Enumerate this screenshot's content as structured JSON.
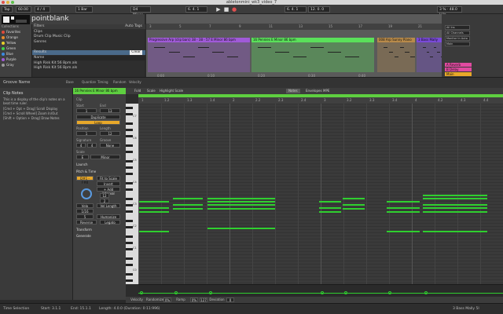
{
  "window_title": "abletonmini_wk3_video_7",
  "transport": {
    "tap": "Tap",
    "tempo": "60.00",
    "sig": "4 / 4",
    "metro": "1 Bar",
    "position": "6. 4. 1",
    "key_root": "D4",
    "key_scale": "Minor",
    "loop_start": "6. 4. 1",
    "loop_len": "12. 0. 0",
    "cpu": "3 %",
    "sr": "48.0 kHz"
  },
  "browser": {
    "brand": "pointblank",
    "collections_label": "Collections",
    "collections": [
      {
        "name": "Favorites",
        "color": "#e04a3a"
      },
      {
        "name": "Orange",
        "color": "#e8892a"
      },
      {
        "name": "Yellow",
        "color": "#e8d12a"
      },
      {
        "name": "Green",
        "color": "#3bd14a"
      },
      {
        "name": "Blue",
        "color": "#3a8ae0"
      },
      {
        "name": "Purple",
        "color": "#a05ad8"
      },
      {
        "name": "Gray",
        "color": "#9a9a9a"
      }
    ],
    "rows": [
      "Filters",
      "Clips",
      "Drum Clip  Music Clip",
      "Genres",
      "Results",
      "Name",
      "High Risk Kit 56 Bpm.als",
      "High Risk Kit 56 Bpm.als"
    ],
    "search_label": "Clear",
    "auto_tag_label": "Auto Tags"
  },
  "arrangement": {
    "ruler_marks": [
      "3",
      "5",
      "7",
      "9",
      "11",
      "13",
      "15",
      "17",
      "19",
      "21"
    ],
    "clips": [
      {
        "name": "Progressive Arp (clip bars) 38 - 38 - 57 E Minor 86 bpm",
        "color": "#a05ad8"
      },
      {
        "name": "16 Pennies E Minor 86 bpm",
        "color": "#5ae05a"
      },
      {
        "name": "008 Arp Sunny Piano",
        "color": "#b88a4a"
      },
      {
        "name": "3 Bass Mally",
        "color": "#7a4ad8"
      }
    ],
    "time_marks": [
      "0:00",
      "0:10",
      "0:20",
      "0:30",
      "0:40"
    ]
  },
  "mixer": {
    "io": [
      "All Ins",
      "All Channels",
      "Monitor In Auto Off",
      "Main"
    ],
    "sends": [
      {
        "label": "A Reverb",
        "color": "#e04aa0"
      },
      {
        "label": "B Delay",
        "color": "#e04aa0"
      },
      {
        "label": "Main",
        "color": "#e8a82a"
      }
    ]
  },
  "separator": {
    "left_label": "Groove Name",
    "cols": [
      "Base",
      "Quantize",
      "Timing",
      "Random",
      "Velocity"
    ],
    "help_title": "Clip Notes",
    "help_body": "This is a display of the clip's notes on a beat time ruler.",
    "help_lines": [
      "[Cmd + Opt + Drag] Scroll Display",
      "[Cmd + Scroll Wheel] Zoom In/Out",
      "[Shift + Option + Drag] Draw Notes"
    ]
  },
  "clip_view": {
    "clip_name": "16 Pennies E Minor 86 bpm",
    "tabs": [
      "Clip",
      "Fold",
      "Scale",
      "Highlight Scale"
    ],
    "labels": [
      "Start",
      "End",
      "Duplicate",
      "Loop",
      "Position",
      "Length",
      "Signature",
      "Groove",
      "Scale",
      "Launch",
      "Pitch & Time",
      "Transform",
      "Generate"
    ],
    "values": {
      "start": "1",
      "end": "13",
      "position": "1",
      "length": "12",
      "sig_num": "4",
      "sig_den": "4",
      "groove": "None",
      "scale_root": "E",
      "scale_name": "Minor",
      "pitch_range": "D#1 - F#8",
      "fit": "Fit to Scale",
      "invert": "Invert",
      "add_interval": "+ Add Interval",
      "intervals": "12",
      "steps": "2",
      "velocity_range": "Vel Length",
      "quant": "1/16",
      "humanize": "Humanize",
      "reverse": "Reverse",
      "legato": "Legato",
      "dropdown_a": "Velo",
      "dropdown_b": "5"
    },
    "editor_tabs": [
      "Notes",
      "Envelopes",
      "MPE"
    ],
    "ruler": [
      "1",
      "1.2",
      "1.3",
      "1.4",
      "2",
      "2.2",
      "2.3",
      "2.4",
      "3",
      "3.2",
      "3.3",
      "3.4",
      "4",
      "4.2",
      "4.3",
      "4.4"
    ],
    "key_labels": [
      "C7",
      "C6",
      "C5",
      "C4",
      "C3",
      "C2",
      "C1",
      "C0"
    ],
    "vel_bar": [
      "Velocity",
      "Randomize",
      "0%",
      "Ramp",
      "0%",
      "127",
      "Deviation",
      "0"
    ]
  },
  "status": {
    "mode": "Time Selection",
    "start": "Start: 3.1.1",
    "end": "End: 15.1.1",
    "length": "Length: 4.0.0 (Duration: 0:11:996)",
    "track": "3 Bass Mally 5I"
  }
}
